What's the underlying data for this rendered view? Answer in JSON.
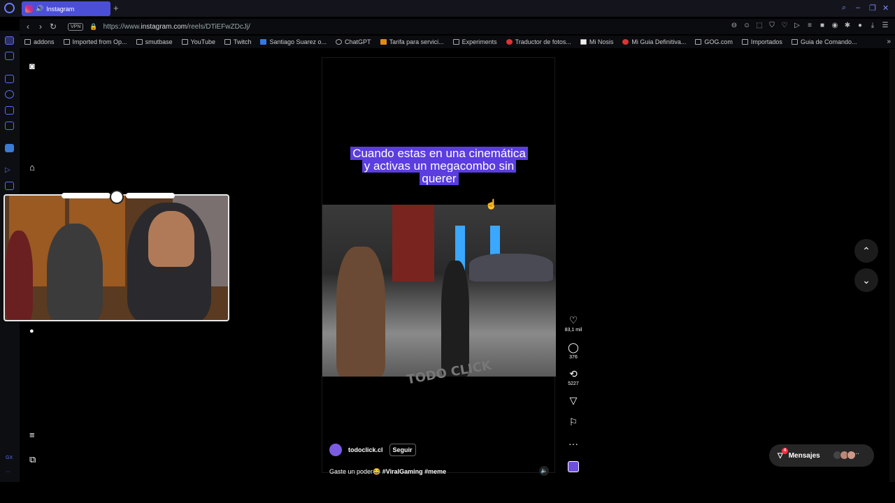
{
  "browser": {
    "tab_title": "Instagram",
    "new_tab": "+",
    "vpn": "VPN",
    "url_prefix": "https://www.",
    "url_domain": "instagram.com",
    "url_path": "/reels/DTiEFwZDcJj/",
    "bookmarks": [
      "addons",
      "Imported from Op...",
      "smutbase",
      "YouTube",
      "Twitch",
      "Santiago Suarez o...",
      "ChatGPT",
      "Tarifa para servici...",
      "Experiments",
      "Traductor de fotos...",
      "Mi Nosis",
      "Mi Guia Definitiva...",
      "GOG.com",
      "Importados",
      "Guia de Comando..."
    ],
    "sidebar_gx": "GX"
  },
  "reel": {
    "caption_lines": [
      "Cuando estas en una cinemática",
      "y activas un megacombo sin",
      "querer"
    ],
    "watermark": "TODO CLICK",
    "author": "todoclick.cl",
    "follow_label": "Seguir",
    "desc_text": "Gaste un poder😂 ",
    "desc_tags": "#ViralGaming #meme"
  },
  "actions": {
    "likes": "83,1 mil",
    "comments": "376",
    "reposts": "5227"
  },
  "messages": {
    "label": "Mensajes",
    "badge": "4"
  },
  "colors": {
    "accent": "#4b4fd8",
    "caption_bg": "#5b3de0",
    "badge": "#ff3040"
  }
}
